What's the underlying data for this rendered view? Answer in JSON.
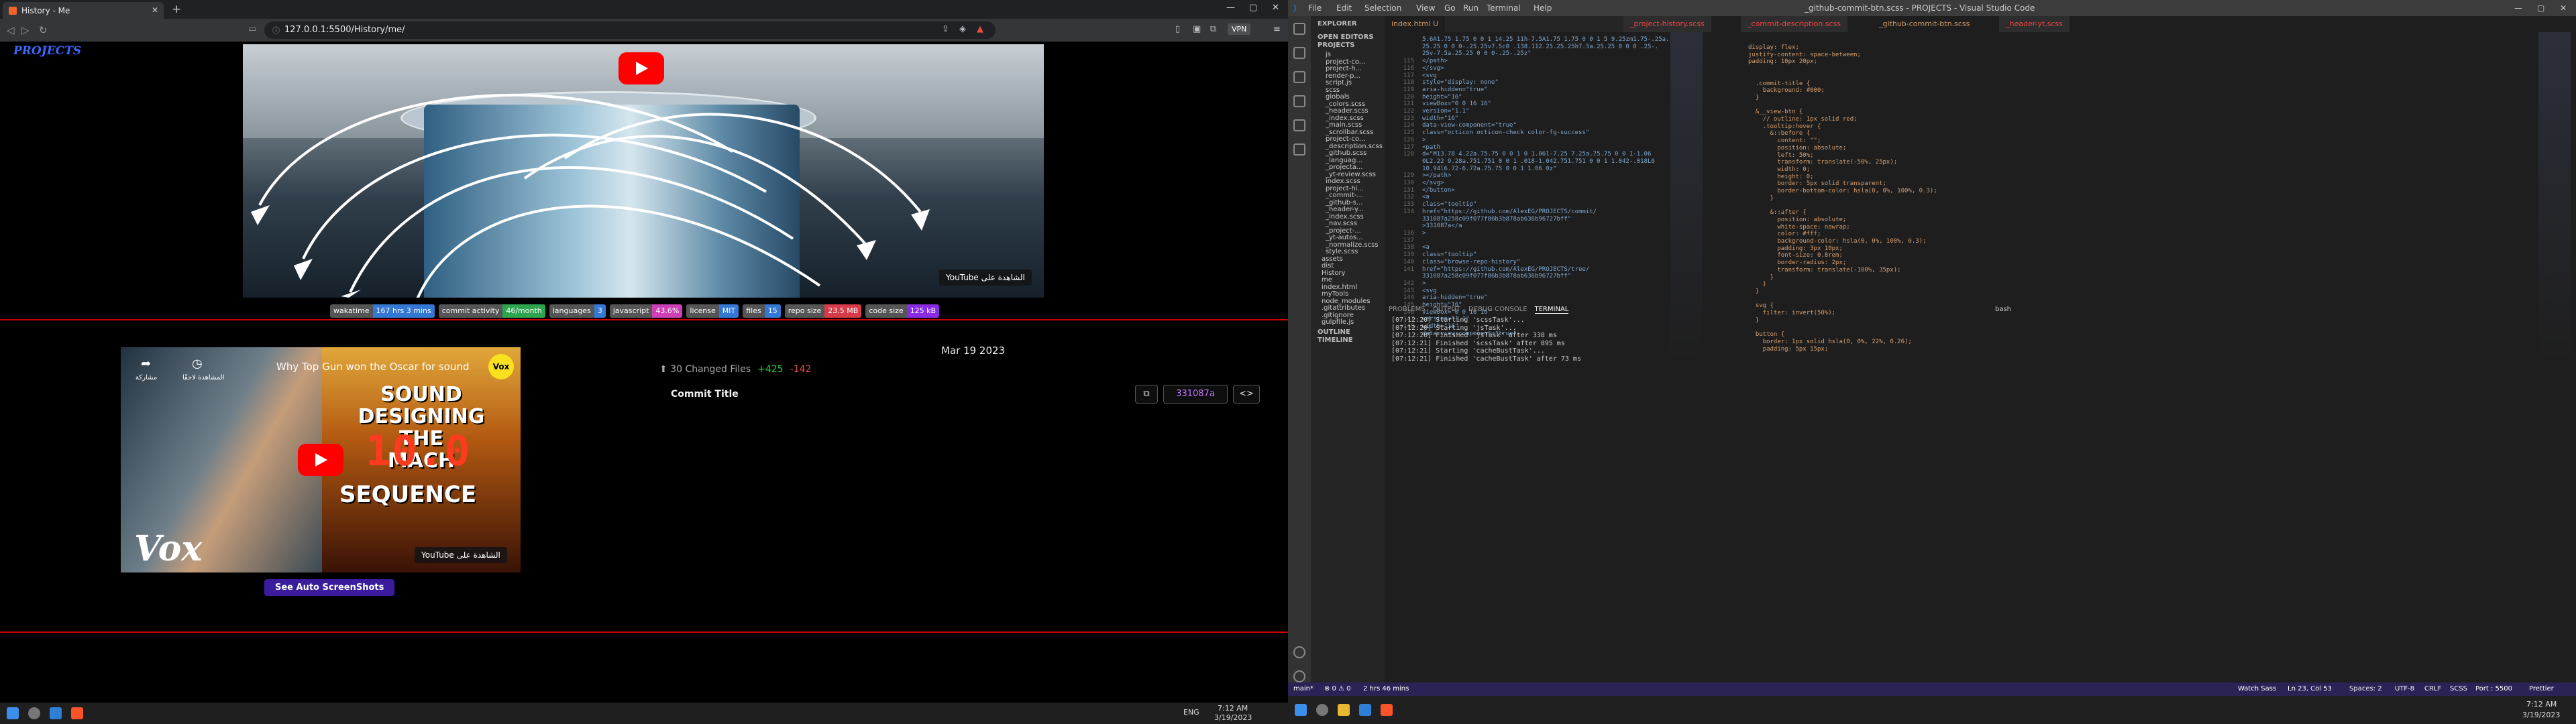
{
  "browser": {
    "tab_title": "History - Me",
    "url": "127.0.0.1:5500/History/me/",
    "vpn": "VPN",
    "brand": "PROJECTS",
    "hero_yt_watch": "الشاهدة على",
    "hero_yt_brand": "YouTube",
    "badges": [
      {
        "k": "wakatime",
        "v": "167 hrs 3 mins",
        "c": "#3478d6"
      },
      {
        "k": "commit activity",
        "v": "46/month",
        "c": "#2ea44f"
      },
      {
        "k": "languages",
        "v": "3",
        "c": "#3478d6"
      },
      {
        "k": "javascript",
        "v": "43.6%",
        "c": "#cc3fb5"
      },
      {
        "k": "license",
        "v": "MIT",
        "c": "#3478d6"
      },
      {
        "k": "files",
        "v": "15",
        "c": "#3478d6"
      },
      {
        "k": "repo size",
        "v": "23.5 MB",
        "c": "#d73a49"
      },
      {
        "k": "code size",
        "v": "125 kB",
        "c": "#8a2be2"
      }
    ],
    "video_title": "Why Top Gun won the Oscar for sound",
    "video_share": "مشاركة",
    "video_later": "المشاهدة لاحقًا",
    "video_big1": "SOUND",
    "video_big2": "DESIGNING THE",
    "video_big3": "MACH",
    "video_num": "10.0",
    "video_seq": "SEQUENCE",
    "video_vox": "Vox",
    "video_vox_badge": "Vox",
    "video_yt_watch": "الشاهدة على",
    "video_yt_brand": "YouTube",
    "screenshots_btn": "See Auto ScreenShots",
    "commit": {
      "date": "Mar 19 2023",
      "changed": "30 Changed Files",
      "plus": "+425",
      "minus": "-142",
      "title": "Commit Title",
      "sha": "331087a",
      "copy_icon": "⧉",
      "code_icon": "<>"
    }
  },
  "taskbar_left": {
    "lang": "ENG",
    "time": "7:12 AM",
    "date": "3/19/2023"
  },
  "vscode": {
    "title": "_github-commit-btn.scss - PROJECTS - Visual Studio Code",
    "menu": [
      "File",
      "Edit",
      "Selection",
      "View",
      "Go",
      "Run",
      "Terminal",
      "Help"
    ],
    "sidebar": {
      "explorer": "EXPLORER",
      "open_editors": "OPEN EDITORS",
      "projects": "PROJECTS",
      "items": [
        "js",
        "project-co...",
        "project-h...",
        "render-p...",
        "script.js",
        "scss",
        "globals",
        "_colors.scss",
        "_header.scss",
        "_index.scss",
        "_main.scss",
        "_scrollbar.scss",
        "project-co...",
        "_description.scss",
        "_github.scss",
        "_languag...",
        "_projecta...",
        "_yt-review.scss",
        "index.scss",
        "project-hi...",
        "_commit-...",
        "_github-s...",
        "_header-y...",
        "_index.scss",
        "_nav.scss",
        "_project-...",
        "_yt-autos...",
        "_normalize.scss",
        "style.scss",
        "assets",
        "dist",
        "History",
        "me",
        "index.html",
        "myTools",
        "node_modules",
        ".gitattributes",
        ".gitignore",
        "gulpfile.js"
      ],
      "outline": "OUTLINE",
      "timeline": "TIMELINE"
    },
    "tabs_left": [
      "index.html U"
    ],
    "tabs_right": [
      "_project-history.scss",
      "_commit-description.scss",
      "_github-commit-btn.scss",
      "_header-yt.scss"
    ],
    "html_lines": [
      "5.6A1.75 1.75 0 0 1 14.25 11h-7.5A1.75 1.75 0 0 1 5 9.25zm1.75-.25a.",
      "25.25 0 0 0-.25.25v7.5c0 .138.112.25.25.25h7.5a.25.25 0 0 0 .25-.",
      "25v-7.5a.25.25 0 0 0-.25-.25z\"",
      "</path>",
      "</svg>",
      "<svg",
      "style=\"display: none\"",
      "aria-hidden=\"true\"",
      "height=\"16\"",
      "viewBox=\"0 0 16 16\"",
      "version=\"1.1\"",
      "width=\"16\"",
      "data-view-component=\"true\"",
      "class=\"octicon octicon-check color-fg-success\"",
      ">",
      "<path",
      "d=\"M13.78 4.22a.75.75 0 0 1 0 1.06l-7.25 7.25a.75.75 0 0 1-1.06",
      "0L2.22 9.28a.751.751 0 0 1 .018-1.042.751.751 0 0 1 1.042-.018L6",
      "10.94l6.72-6.72a.75.75 0 0 1 1.06 0z\"",
      "></path>",
      "</svg>",
      "</button>",
      "<a",
      "class=\"tooltip\"",
      "href=\"https://github.com/AlexEG/PROJECTS/commit/",
      "331087a258c09f077f86b3b878ab636b96727bff\"",
      ">331087a</a",
      ">",
      "",
      "<a",
      "class=\"tooltip\"",
      "class=\"browse-repo-history\"",
      "href=\"https://github.com/AlexEG/PROJECTS/tree/",
      "331087a258c09f077f86b3b878ab636b96727bff\"",
      ">",
      "<svg",
      "aria-hidden=\"true\"",
      "height=\"16\"",
      "viewBox=\"0 0 16 16\"",
      "version=\"1.1\"",
      "width=\"16\"",
      "data-view-component=\"true\""
    ],
    "html_numbers": [
      "",
      "",
      "",
      "115",
      "116",
      "117",
      "118",
      "119",
      "120",
      "121",
      "122",
      "123",
      "124",
      "125",
      "126",
      "127",
      "128",
      "",
      "",
      "129",
      "130",
      "131",
      "132",
      "133",
      "134",
      "",
      "",
      "136",
      "137",
      "138",
      "139",
      "140",
      "141",
      "",
      "142",
      "143",
      "144",
      "145",
      "146",
      "147",
      "148"
    ],
    "scss_lines": [
      "display: flex;",
      "justify-content: space-between;",
      "padding: 10px 20px;",
      "",
      "",
      "  .commit-title {",
      "    background: #000;",
      "  }",
      "",
      "  &__view-btn {",
      "    // outline: 1px solid red;",
      "    .tooltip:hover {",
      "      &::before {",
      "        content: \"\";",
      "        position: absolute;",
      "        left: 50%;",
      "        transform: translate(-50%, 25px);",
      "        width: 0;",
      "        height: 0;",
      "        border: 5px solid transparent;",
      "        border-bottom-color: hsla(0, 0%, 100%, 0.3);",
      "      }",
      "",
      "      &::after {",
      "        position: absolute;",
      "        white-space: nowrap;",
      "        color: #fff;",
      "        background-color: hsla(0, 0%, 100%, 0.3);",
      "        padding: 3px 10px;",
      "        font-size: 0.8rem;",
      "        border-radius: 2px;",
      "        transform: translate(-100%, 35px);",
      "      }",
      "    }",
      "  }",
      "",
      "  svg {",
      "    filter: invert(50%);",
      "  }",
      "",
      "  button {",
      "    border: 1px solid hsla(0, 0%, 22%, 0.26);",
      "    padding: 5px 15px;"
    ],
    "panel_tabs": [
      "PROBLEMS",
      "OUTPUT",
      "DEBUG CONSOLE",
      "TERMINAL"
    ],
    "terminal_shell": "bash",
    "terminal": [
      "[07:12:20] Starting 'scssTask'...",
      "[07:12:20] Starting 'jsTask'...",
      "[07:12:20] Finished 'jsTask' after 338 ms",
      "[07:12:21] Finished 'scssTask' after 895 ms",
      "[07:12:21] Starting 'cacheBustTask'...",
      "[07:12:21] Finished 'cacheBustTask' after 73 ms"
    ],
    "status_left": [
      "main*",
      "⊗ 0 ⚠ 0",
      "2 hrs 46 mins"
    ],
    "status_right": [
      "Watch Sass",
      "Ln 23, Col 53",
      "Spaces: 2",
      "UTF-8",
      "CRLF",
      "SCSS",
      "Port : 5500",
      "Prettier"
    ],
    "clock_time": "7:12 AM",
    "clock_date": "3/19/2023"
  }
}
